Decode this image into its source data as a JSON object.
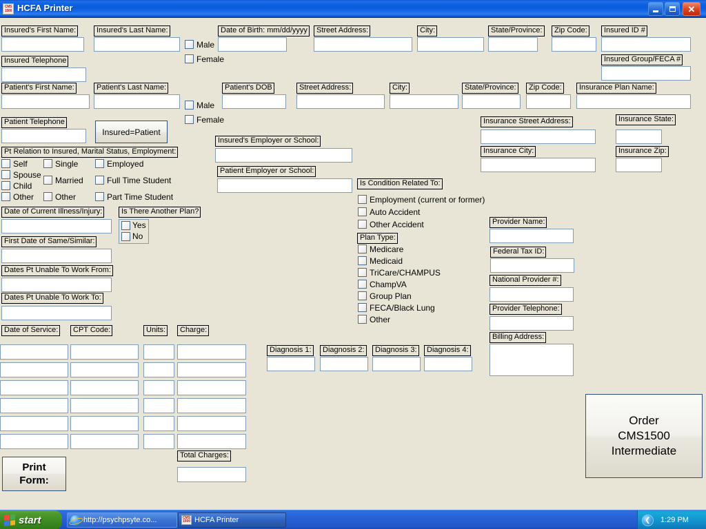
{
  "window": {
    "title": "HCFA Printer",
    "icon_name": "cms-form-icon",
    "icon_text_top": "CMS",
    "icon_text_bottom": "1500",
    "minimize_label": "",
    "maximize_label": "",
    "close_label": "✕"
  },
  "insured": {
    "first_name_label": "Insured's First Name:",
    "last_name_label": "Insured's Last Name:",
    "dob_label": "Date of Birth: mm/dd/yyyy",
    "street_label": "Street Address:",
    "city_label": "City:",
    "state_label": "State/Province:",
    "zip_label": "Zip Code:",
    "id_label": "Insured ID #",
    "group_feca_label": "Insured Group/FECA #",
    "telephone_label": "Insured Telephone",
    "male_label": "Male",
    "female_label": "Female",
    "first_name_value": "",
    "last_name_value": "",
    "dob_value": "",
    "street_value": "",
    "city_value": "",
    "state_value": "",
    "zip_value": "",
    "id_value": "",
    "group_feca_value": "",
    "telephone_value": ""
  },
  "patient": {
    "first_name_label": "Patient's First Name:",
    "last_name_label": "Patient's Last Name:",
    "dob_label": "Patient's DOB",
    "street_label": "Street Address:",
    "city_label": "City:",
    "state_label": "State/Province:",
    "zip_label": "Zip Code:",
    "plan_name_label": "Insurance Plan Name:",
    "telephone_label": "Patient Telephone",
    "male_label": "Male",
    "female_label": "Female",
    "insured_equals_patient_label": "Insured=Patient",
    "first_name_value": "",
    "last_name_value": "",
    "dob_value": "",
    "street_value": "",
    "city_value": "",
    "state_value": "",
    "zip_value": "",
    "plan_name_value": "",
    "telephone_value": ""
  },
  "relation_group": {
    "title": "Pt Relation to Insured, Marital Status, Employment:",
    "relation": [
      "Self",
      "Spouse",
      "Child",
      "Other"
    ],
    "marital": [
      "Single",
      "Married",
      "Other"
    ],
    "employment": [
      "Employed",
      "Full Time Student",
      "Part Time Student"
    ]
  },
  "employer": {
    "insured_label": "Insured's Employer or School:",
    "patient_label": "Patient Employer or School:",
    "insured_value": "",
    "patient_value": ""
  },
  "insurance": {
    "street_label": "Insurance Street Address:",
    "city_label": "Insurance City:",
    "state_label": "Insurance State:",
    "zip_label": "Insurance Zip:",
    "street_value": "",
    "city_value": "",
    "state_value": "",
    "zip_value": ""
  },
  "illness": {
    "current_label": "Date of Current Illness/Injury:",
    "same_similar_label": "First Date of Same/Similar:",
    "unable_from_label": "Dates Pt Unable To Work From:",
    "unable_to_label": "Dates Pt Unable To Work To:",
    "current_value": "",
    "same_similar_value": "",
    "unable_from_value": "",
    "unable_to_value": ""
  },
  "another_plan": {
    "title": "Is There Another Plan?",
    "options": [
      "Yes",
      "No"
    ]
  },
  "condition": {
    "title": "Is Condition Related To:",
    "options": [
      "Employment (current or former)",
      "Auto Accident",
      "Other Accident"
    ]
  },
  "plan_type": {
    "title": "Plan Type:",
    "options": [
      "Medicare",
      "Medicaid",
      "TriCare/CHAMPUS",
      "ChampVA",
      "Group Plan",
      "FECA/Black Lung",
      "Other"
    ]
  },
  "provider": {
    "name_label": "Provider Name:",
    "tax_id_label": "Federal Tax ID:",
    "npi_label": "National Provider #:",
    "telephone_label": "Provider Telephone:",
    "billing_address_label": "Billing Address:",
    "name_value": "",
    "tax_id_value": "",
    "npi_value": "",
    "telephone_value": "",
    "billing_address_value": ""
  },
  "services": {
    "headers": [
      "Date of Service:",
      "CPT Code:",
      "Units:",
      "Charge:"
    ],
    "rows": [
      {
        "date": "",
        "cpt": "",
        "units": "",
        "charge": ""
      },
      {
        "date": "",
        "cpt": "",
        "units": "",
        "charge": ""
      },
      {
        "date": "",
        "cpt": "",
        "units": "",
        "charge": ""
      },
      {
        "date": "",
        "cpt": "",
        "units": "",
        "charge": ""
      },
      {
        "date": "",
        "cpt": "",
        "units": "",
        "charge": ""
      },
      {
        "date": "",
        "cpt": "",
        "units": "",
        "charge": ""
      }
    ],
    "total_label": "Total Charges:",
    "total_value": ""
  },
  "diagnosis": {
    "labels": [
      "Diagnosis 1:",
      "Diagnosis 2:",
      "Diagnosis 3:",
      "Diagnosis 4:"
    ],
    "values": [
      "",
      "",
      "",
      ""
    ]
  },
  "actions": {
    "print_form_label": "Print\nForm:",
    "print_form_line1": "Print",
    "print_form_line2": "Form:",
    "order_line1": "Order",
    "order_line2": "CMS1500",
    "order_line3": "Intermediate"
  },
  "taskbar": {
    "start_label": "start",
    "items": [
      {
        "label": "http://psychpsyte.co...",
        "icon": "internet-explorer-icon"
      },
      {
        "label": "HCFA Printer",
        "icon": "cms-form-icon"
      }
    ],
    "tray_chevron": "❮",
    "clock": "1:29 PM"
  },
  "colors": {
    "form_bg": "#e9e5d6",
    "field_border": "#7f9db9",
    "title_blue": "#0b5ada",
    "taskbar_blue": "#2b64d8",
    "start_green": "#4d9a2c",
    "close_red": "#e04a28"
  }
}
